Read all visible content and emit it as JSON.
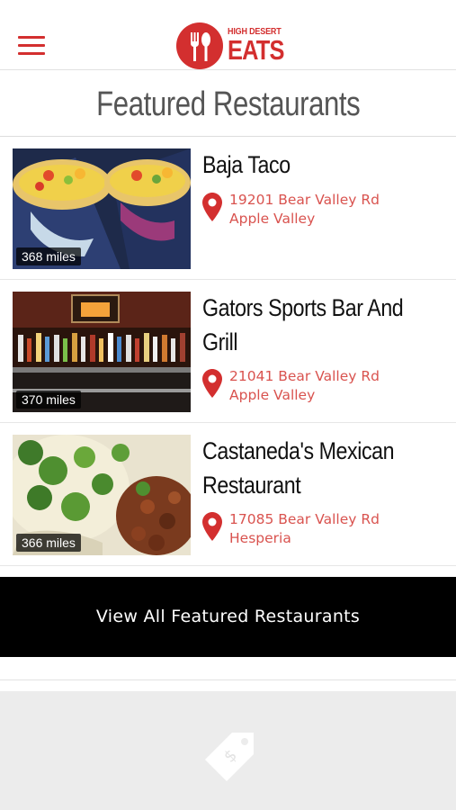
{
  "header": {
    "logo_small": "HIGH DESERT",
    "logo_big": "EATS",
    "brand_color": "#d32f2f"
  },
  "section": {
    "title": "Featured Restaurants"
  },
  "restaurants": [
    {
      "name": "Baja Taco",
      "address": "19201 Bear Valley Rd Apple Valley",
      "distance": "368 miles",
      "image": "tacos-photo"
    },
    {
      "name": "Gators Sports Bar And Grill",
      "address": "21041 Bear Valley Rd Apple Valley",
      "distance": "370 miles",
      "image": "bar-photo"
    },
    {
      "name": "Castaneda's Mexican Restaurant",
      "address": "17085 Bear Valley Rd Hesperia",
      "distance": "366 miles",
      "image": "street-tacos-photo"
    }
  ],
  "cta": {
    "label": "View All Featured Restaurants"
  },
  "icons": {
    "menu": "hamburger-menu-icon",
    "pin": "map-pin-icon",
    "tag": "price-tag-icon"
  },
  "colors": {
    "accent": "#d32f2f",
    "address": "#d9534f",
    "cta_bg": "#000000",
    "footer_bg": "#ececec"
  }
}
